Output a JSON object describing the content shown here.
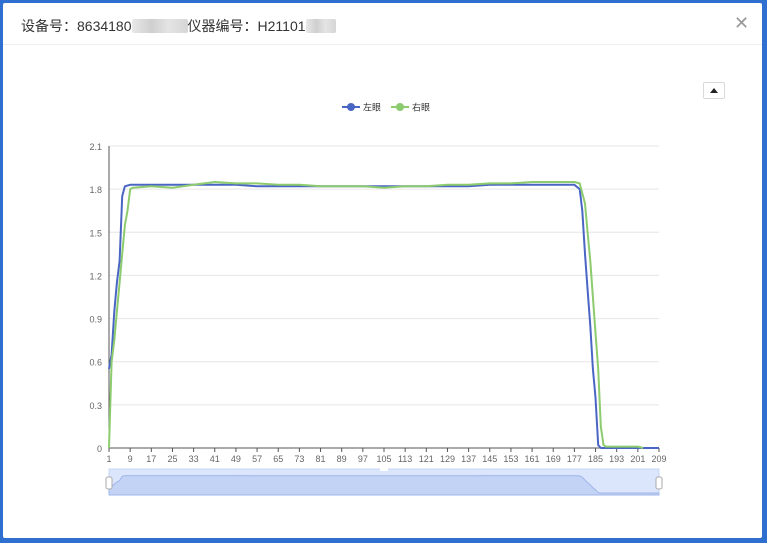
{
  "header": {
    "device_label": "设备号：",
    "device_value_visible": "8634180",
    "instrument_label": "仪器编号：",
    "instrument_value_visible": "H21101"
  },
  "close_icon": "close-icon",
  "colors": {
    "series_left": "#4a66c4",
    "series_right": "#8ccb6e",
    "grid": "#e6e6e6",
    "axis": "#555555",
    "zoom_fill": "#dbe5fb",
    "zoom_border": "#c7d6f6"
  },
  "chart_data": {
    "type": "line",
    "title": "",
    "xlabel": "",
    "ylabel": "",
    "ylim": [
      0,
      2.1
    ],
    "yticks": [
      0,
      0.3,
      0.6,
      0.9,
      1.2,
      1.5,
      1.8,
      2.1
    ],
    "ytick_labels": [
      "0",
      "0.3",
      "0.6",
      "0.9",
      "1.2",
      "1.5",
      "1.8",
      "2.1"
    ],
    "xlim": [
      1,
      209
    ],
    "xticks": [
      1,
      9,
      17,
      25,
      33,
      41,
      49,
      57,
      65,
      73,
      81,
      89,
      97,
      105,
      113,
      121,
      129,
      137,
      145,
      153,
      161,
      169,
      177,
      185,
      193,
      201,
      209
    ],
    "xtick_labels": [
      "1",
      "9",
      "17",
      "25",
      "33",
      "41",
      "49",
      "57",
      "65",
      "73",
      "81",
      "89",
      "97",
      "105",
      "113",
      "121",
      "129",
      "137",
      "145",
      "153",
      "161",
      "169",
      "177",
      "185",
      "193",
      "201",
      "209"
    ],
    "grid": true,
    "legend_position": "top-center",
    "series": [
      {
        "name": "左眼",
        "points": [
          [
            1,
            0.55
          ],
          [
            2,
            0.65
          ],
          [
            3,
            0.95
          ],
          [
            4,
            1.15
          ],
          [
            5,
            1.3
          ],
          [
            6,
            1.75
          ],
          [
            7,
            1.82
          ],
          [
            9,
            1.83
          ],
          [
            17,
            1.83
          ],
          [
            25,
            1.83
          ],
          [
            33,
            1.83
          ],
          [
            41,
            1.83
          ],
          [
            49,
            1.83
          ],
          [
            57,
            1.82
          ],
          [
            65,
            1.82
          ],
          [
            73,
            1.82
          ],
          [
            81,
            1.82
          ],
          [
            89,
            1.82
          ],
          [
            97,
            1.82
          ],
          [
            105,
            1.82
          ],
          [
            113,
            1.82
          ],
          [
            121,
            1.82
          ],
          [
            129,
            1.82
          ],
          [
            137,
            1.82
          ],
          [
            145,
            1.83
          ],
          [
            153,
            1.83
          ],
          [
            161,
            1.83
          ],
          [
            169,
            1.83
          ],
          [
            177,
            1.83
          ],
          [
            179,
            1.8
          ],
          [
            180,
            1.65
          ],
          [
            181,
            1.35
          ],
          [
            182,
            1.1
          ],
          [
            183,
            0.85
          ],
          [
            184,
            0.55
          ],
          [
            185,
            0.35
          ],
          [
            186,
            0.02
          ],
          [
            187,
            0
          ],
          [
            209,
            0
          ]
        ]
      },
      {
        "name": "右眼",
        "points": [
          [
            1,
            0
          ],
          [
            2,
            0.6
          ],
          [
            3,
            0.75
          ],
          [
            4,
            0.95
          ],
          [
            5,
            1.15
          ],
          [
            6,
            1.35
          ],
          [
            7,
            1.55
          ],
          [
            8,
            1.65
          ],
          [
            9,
            1.8
          ],
          [
            10,
            1.81
          ],
          [
            17,
            1.82
          ],
          [
            25,
            1.81
          ],
          [
            33,
            1.83
          ],
          [
            41,
            1.85
          ],
          [
            49,
            1.84
          ],
          [
            57,
            1.84
          ],
          [
            65,
            1.83
          ],
          [
            73,
            1.83
          ],
          [
            81,
            1.82
          ],
          [
            89,
            1.82
          ],
          [
            97,
            1.82
          ],
          [
            105,
            1.81
          ],
          [
            113,
            1.82
          ],
          [
            121,
            1.82
          ],
          [
            129,
            1.83
          ],
          [
            137,
            1.83
          ],
          [
            145,
            1.84
          ],
          [
            153,
            1.84
          ],
          [
            161,
            1.85
          ],
          [
            169,
            1.85
          ],
          [
            177,
            1.85
          ],
          [
            179,
            1.84
          ],
          [
            181,
            1.7
          ],
          [
            182,
            1.5
          ],
          [
            183,
            1.3
          ],
          [
            184,
            1.05
          ],
          [
            185,
            0.8
          ],
          [
            186,
            0.55
          ],
          [
            187,
            0.15
          ],
          [
            188,
            0.02
          ],
          [
            189,
            0.01
          ],
          [
            201,
            0.01
          ],
          [
            203,
            0
          ]
        ]
      }
    ]
  }
}
